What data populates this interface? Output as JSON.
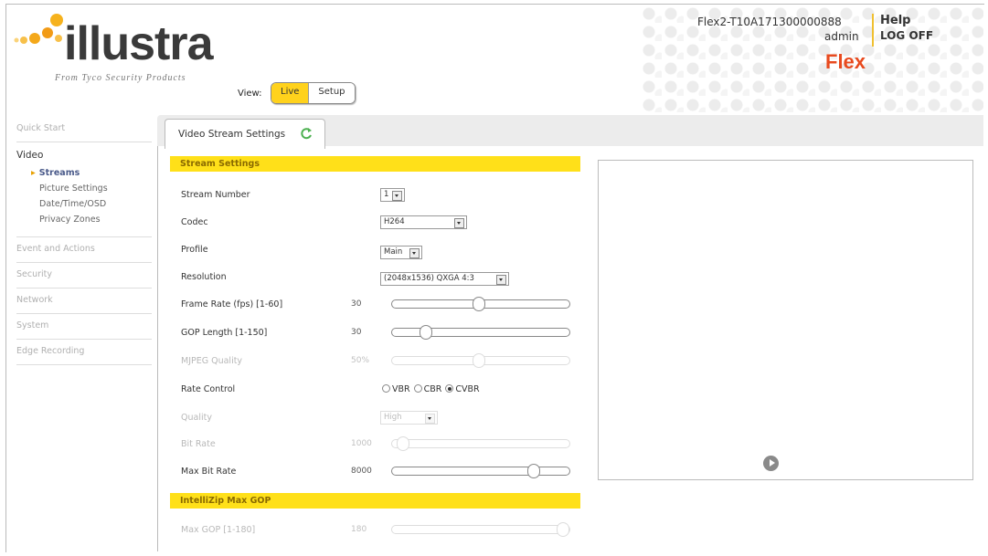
{
  "brand": {
    "logo_text": "illustra",
    "logo_sub": "From Tyco Security Products",
    "product": "Flex"
  },
  "view": {
    "label": "View:",
    "options": [
      "Live",
      "Setup"
    ],
    "active": "Live"
  },
  "header": {
    "device_name": "Flex2-T10A171300000888",
    "user": "admin",
    "help": "Help",
    "logoff": "LOG OFF"
  },
  "sidebar": {
    "quick_start": "Quick Start",
    "video": "Video",
    "video_items": [
      "Streams",
      "Picture Settings",
      "Date/Time/OSD",
      "Privacy Zones"
    ],
    "current": "Streams",
    "sections": [
      "Event and Actions",
      "Security",
      "Network",
      "System",
      "Edge Recording"
    ]
  },
  "tab": {
    "label": "Video Stream Settings"
  },
  "stream_settings": {
    "title": "Stream Settings",
    "stream_number": {
      "label": "Stream Number",
      "value": "1"
    },
    "codec": {
      "label": "Codec",
      "value": "H264"
    },
    "profile": {
      "label": "Profile",
      "value": "Main"
    },
    "resolution": {
      "label": "Resolution",
      "value": "(2048x1536) QXGA 4:3"
    },
    "frame_rate": {
      "label": "Frame Rate (fps) [1-60]",
      "value": "30",
      "fraction": 0.49
    },
    "gop_length": {
      "label": "GOP Length [1-150]",
      "value": "30",
      "fraction": 0.19
    },
    "mjpeg_quality": {
      "label": "MJPEG Quality",
      "value": "50%",
      "fraction": 0.49
    },
    "rate_control": {
      "label": "Rate Control",
      "options": [
        "VBR",
        "CBR",
        "CVBR"
      ],
      "selected": "CVBR"
    },
    "quality": {
      "label": "Quality",
      "value": "High"
    },
    "bit_rate": {
      "label": "Bit Rate",
      "value": "1000",
      "fraction": 0.06
    },
    "max_bit_rate": {
      "label": "Max Bit Rate",
      "value": "8000",
      "fraction": 0.8
    }
  },
  "intellizip": {
    "title": "IntelliZip Max GOP",
    "max_gop": {
      "label": "Max GOP [1-180]",
      "value": "180",
      "fraction": 1.0
    }
  },
  "colors": {
    "accent": "#ffd21c",
    "section_bar": "#ffe019",
    "brand_orange": "#e84a1e"
  }
}
